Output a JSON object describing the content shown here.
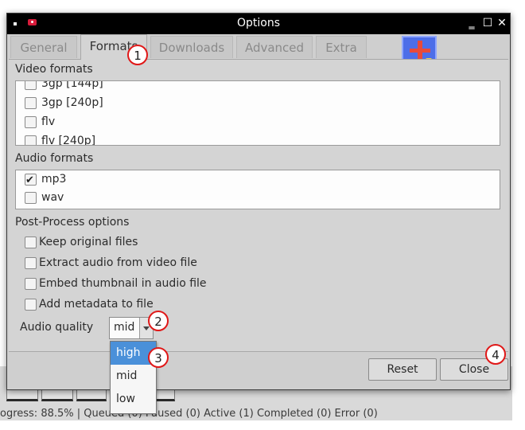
{
  "window": {
    "title": "Options"
  },
  "tabs": [
    "General",
    "Formats",
    "Downloads",
    "Advanced",
    "Extra"
  ],
  "video_formats": {
    "label": "Video formats",
    "items": [
      {
        "label": "3gp [144p]",
        "checked": false
      },
      {
        "label": "3gp [240p]",
        "checked": false
      },
      {
        "label": "flv",
        "checked": false
      },
      {
        "label": "flv [240p]",
        "checked": false
      }
    ]
  },
  "audio_formats": {
    "label": "Audio formats",
    "items": [
      {
        "label": "mp3",
        "checked": true
      },
      {
        "label": "wav",
        "checked": false
      }
    ]
  },
  "post_process": {
    "label": "Post-Process options",
    "items": [
      {
        "label": "Keep original files",
        "checked": false
      },
      {
        "label": "Extract audio from video file",
        "checked": false
      },
      {
        "label": "Embed thumbnail in audio file",
        "checked": false
      },
      {
        "label": "Add metadata to file",
        "checked": false
      }
    ]
  },
  "audio_quality": {
    "label": "Audio quality",
    "value": "mid",
    "options": [
      "high",
      "mid",
      "low"
    ],
    "highlighted": "high"
  },
  "buttons": {
    "reset": "Reset",
    "close": "Close"
  },
  "status_text": "ogress: 88.5% | Queued (0) Paused (0) Active (1) Completed (0) Error (0)",
  "markers": [
    "1",
    "2",
    "3",
    "4"
  ],
  "colors": {
    "marker_border": "#e01818",
    "selection": "#4a90d9",
    "titlebar": "#000000"
  }
}
